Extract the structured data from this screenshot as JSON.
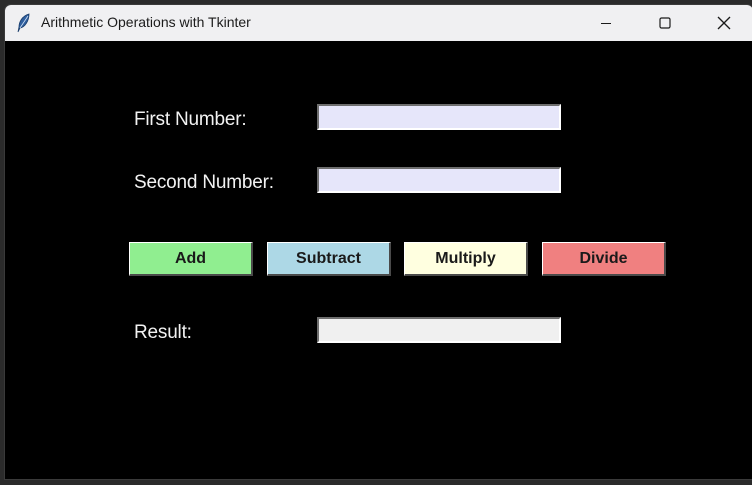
{
  "window": {
    "title": "Arithmetic Operations with Tkinter"
  },
  "form": {
    "first_label": "First Number:",
    "first_value": "",
    "second_label": "Second Number:",
    "second_value": "",
    "result_label": "Result:",
    "result_value": ""
  },
  "buttons": {
    "add": "Add",
    "subtract": "Subtract",
    "multiply": "Multiply",
    "divide": "Divide"
  },
  "colors": {
    "background": "#000000",
    "entry_bg": "#e6e6fa",
    "result_bg": "#f0f0f0",
    "add": "#90ee90",
    "subtract": "#add8e6",
    "multiply": "#ffffe0",
    "divide": "#f08080"
  },
  "icons": {
    "app": "feather-icon",
    "minimize": "minimize-icon",
    "maximize": "maximize-icon",
    "close": "close-icon"
  }
}
